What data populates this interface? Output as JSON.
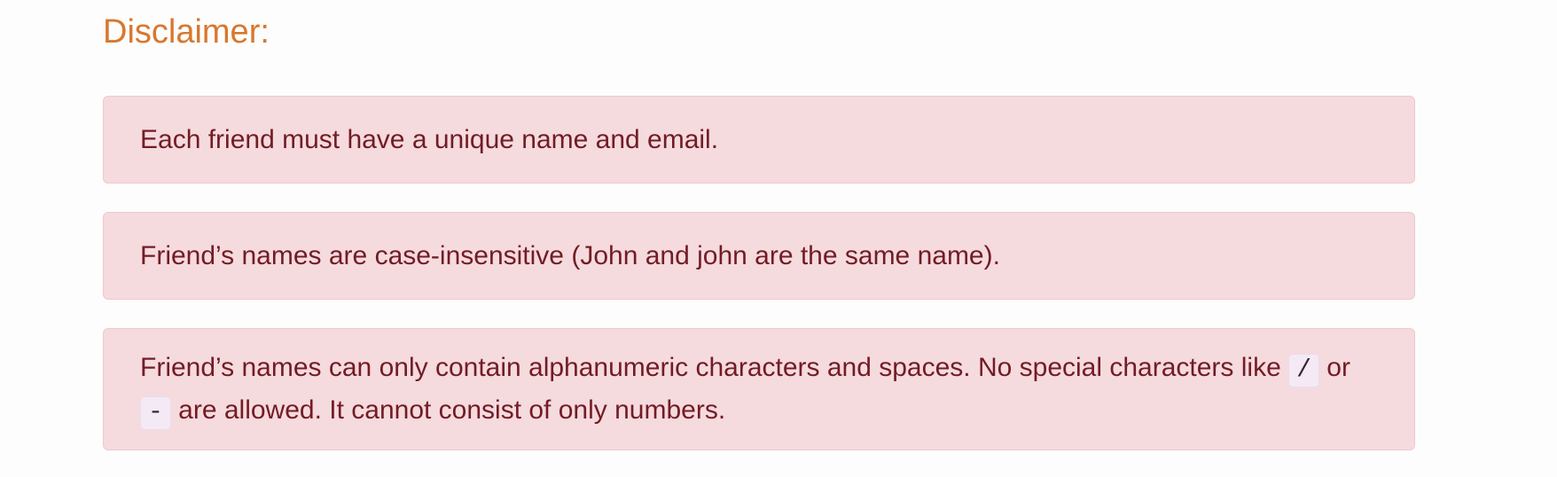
{
  "disclaimer": {
    "heading": "Disclaimer:",
    "notes": {
      "unique": "Each friend must have a unique name and email.",
      "case_insensitive": "Friend’s names are case-insensitive (John and john are the same name).",
      "allowed_chars": {
        "text_before": "Friend’s names can only contain alphanumeric characters and spaces. No special characters like",
        "code_slash": "/",
        "text_or": "or",
        "code_dash": "-",
        "text_after": "are allowed. It cannot consist of only numbers."
      }
    }
  },
  "colors": {
    "heading": "#d9772e",
    "alert_bg": "#f5dade",
    "alert_border": "#f0c9cf",
    "alert_text": "#721c24"
  }
}
